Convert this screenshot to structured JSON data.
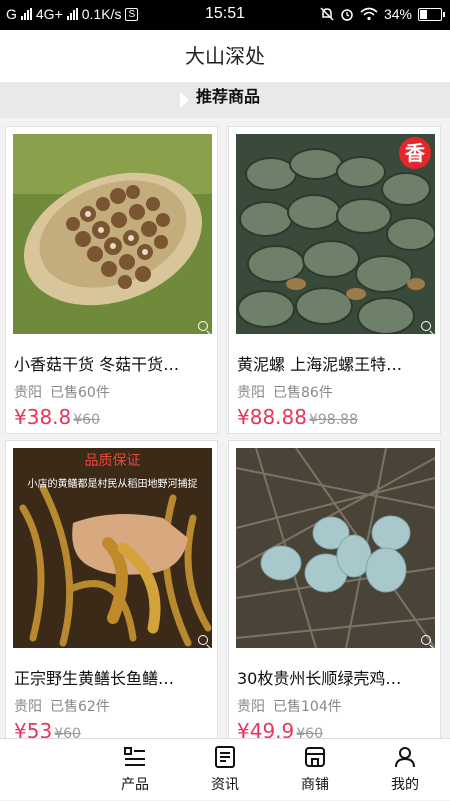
{
  "status_bar": {
    "carrier": "G",
    "network": "4G+",
    "speed": "0.1K/s",
    "s_badge": "S",
    "time": "15:51",
    "battery": "34%",
    "battery_level": 0.34
  },
  "header": {
    "title": "大山深处"
  },
  "section": {
    "title": "推荐商品"
  },
  "products": [
    {
      "name": "小香菇干货 冬菇干货…",
      "location": "贵阳",
      "sold": "已售60件",
      "price": "¥38.8",
      "old_price": "¥60"
    },
    {
      "name": "黄泥螺 上海泥螺王特…",
      "location": "贵阳",
      "sold": "已售86件",
      "price": "¥88.88",
      "old_price": "¥98.88",
      "badge": "香"
    },
    {
      "name": "正宗野生黄鳝长鱼鳝…",
      "location": "贵阳",
      "sold": "已售62件",
      "price": "¥53",
      "old_price": "¥60",
      "overlay_title": "品质保证",
      "overlay_caption": "小店的黄鳝都是村民从稻田地野河捕捉"
    },
    {
      "name": "30枚贵州长顺绿壳鸡…",
      "location": "贵阳",
      "sold": "已售104件",
      "price": "¥49.9",
      "old_price": "¥60"
    }
  ],
  "tabbar": {
    "items": [
      {
        "label": "产品",
        "icon": "list-icon"
      },
      {
        "label": "资讯",
        "icon": "news-icon"
      },
      {
        "label": "商铺",
        "icon": "store-icon"
      },
      {
        "label": "我的",
        "icon": "user-icon"
      }
    ]
  }
}
